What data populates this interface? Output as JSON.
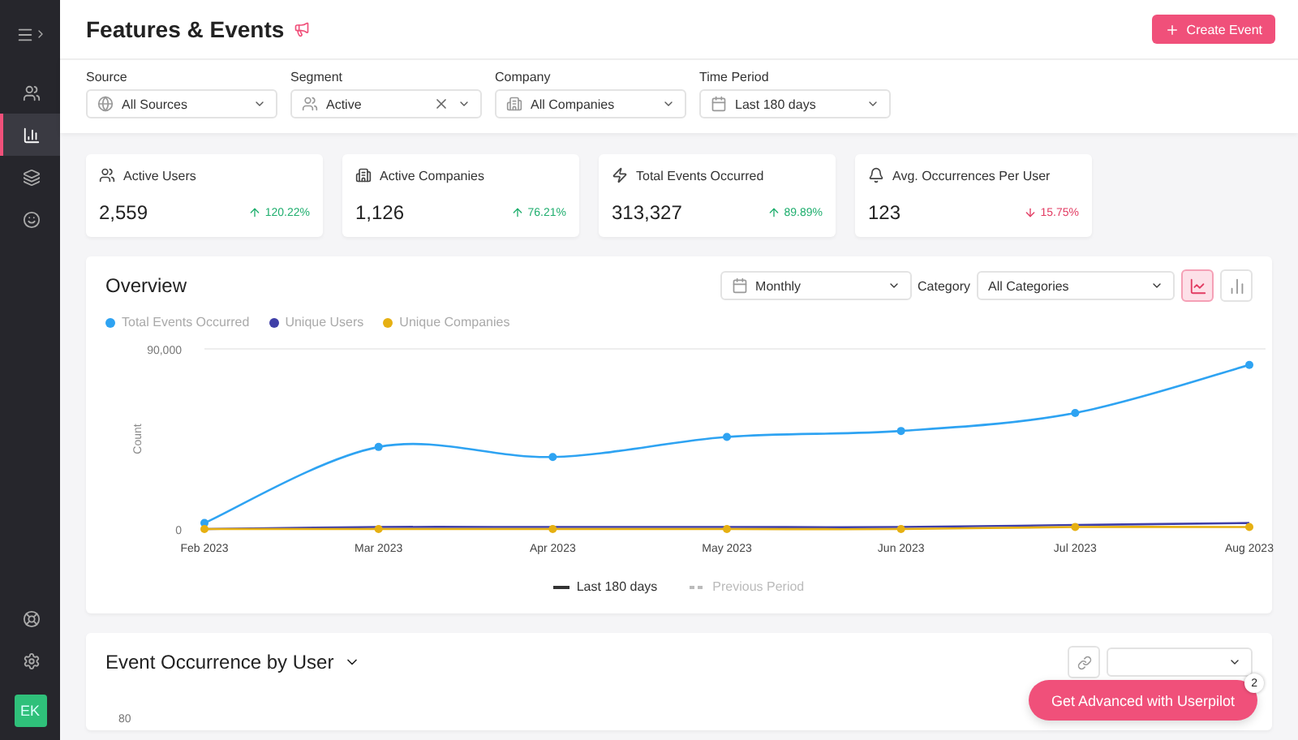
{
  "sidebar": {
    "items": [
      {
        "selected": false
      },
      {
        "selected": true
      },
      {
        "selected": false
      },
      {
        "selected": false
      }
    ],
    "avatar": "EK"
  },
  "header": {
    "title": "Features & Events",
    "button": "Create Event"
  },
  "filters": [
    {
      "label": "Source",
      "value": "All Sources",
      "clearable": false
    },
    {
      "label": "Segment",
      "value": "Active",
      "clearable": true
    },
    {
      "label": "Company",
      "value": "All Companies",
      "clearable": false
    },
    {
      "label": "Time Period",
      "value": "Last 180 days",
      "clearable": false
    }
  ],
  "metrics": [
    {
      "label": "Active Users",
      "value": "2,559",
      "change": "120.22%",
      "kind": "up"
    },
    {
      "label": "Active Companies",
      "value": "1,126",
      "change": "76.21%",
      "kind": "up"
    },
    {
      "label": "Total Events Occurred",
      "value": "313,327",
      "change": "89.89%",
      "kind": "up"
    },
    {
      "label": "Avg. Occurrences Per User",
      "value": "123",
      "change": "15.75%",
      "kind": "down"
    }
  ],
  "overview": {
    "title": "Overview",
    "interval": "Monthly",
    "category_label": "Category",
    "category": "All Categories",
    "views": [
      {
        "kind": "line",
        "selected": true
      },
      {
        "kind": "bar",
        "selected": false
      }
    ],
    "chart_data": {
      "type": "line",
      "ylabel": "Count",
      "categories": [
        "Feb 2023",
        "Mar 2023",
        "Apr 2023",
        "May 2023",
        "Jun 2023",
        "Jul 2023",
        "Aug 2023"
      ],
      "ylim": [
        0,
        90000
      ],
      "yticks": [
        0,
        {
          "value": 90000,
          "label": "90,000"
        }
      ],
      "series": [
        {
          "name": "Total Events Occurred",
          "color": "#2ea3f2",
          "marker": "circle",
          "values": [
            3000,
            41000,
            36000,
            46000,
            49000,
            58000,
            82000
          ]
        },
        {
          "name": "Unique Users",
          "color": "#3f3fa8",
          "marker": "none",
          "values": [
            0,
            1000,
            1000,
            1000,
            1000,
            2000,
            3000
          ]
        },
        {
          "name": "Unique Companies",
          "color": "#e6b012",
          "marker": "circle",
          "values": [
            0,
            0,
            0,
            0,
            0,
            1000,
            1000
          ]
        }
      ]
    },
    "period_legend": [
      {
        "label": "Last 180 days",
        "kind": "solid",
        "active": true
      },
      {
        "label": "Previous Period",
        "kind": "dashed",
        "active": false
      }
    ]
  },
  "event_occurrence": {
    "title": "Event Occurrence by User",
    "y_tick": "80"
  },
  "promo": {
    "label": "Get Advanced with Userpilot",
    "badge": "2"
  }
}
